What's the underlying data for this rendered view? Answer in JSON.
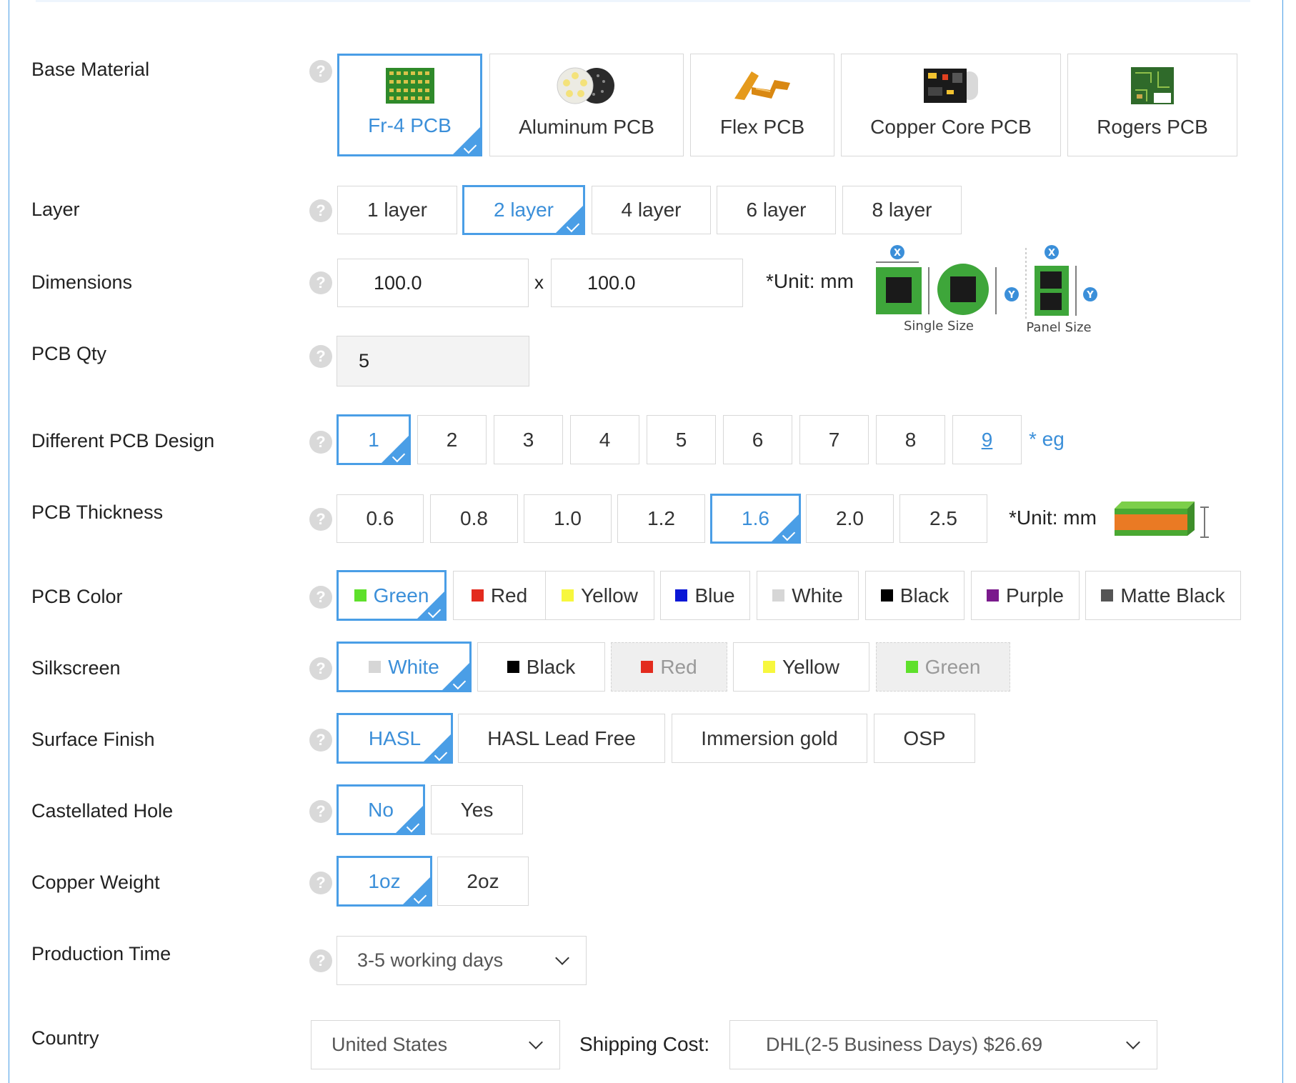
{
  "colors": {
    "accent": "#4a9ee6",
    "accent_text": "#3b8fd9"
  },
  "base_material": {
    "label": "Base Material",
    "options": [
      "Fr-4 PCB",
      "Aluminum PCB",
      "Flex PCB",
      "Copper Core PCB",
      "Rogers PCB"
    ],
    "selected": "Fr-4 PCB"
  },
  "layer": {
    "label": "Layer",
    "options": [
      "1 layer",
      "2 layer",
      "4 layer",
      "6 layer",
      "8 layer"
    ],
    "selected": "2 layer"
  },
  "dimensions": {
    "label": "Dimensions",
    "width_value": "100.0",
    "separator": "x",
    "height_value": "100.0",
    "unit": "*Unit: mm",
    "diagram_single": "Single Size",
    "diagram_panel": "Panel Size",
    "axis_x": "X",
    "axis_y": "Y"
  },
  "pcb_qty": {
    "label": "PCB Qty",
    "value": "5"
  },
  "different_design": {
    "label": "Different PCB Design",
    "options": [
      "1",
      "2",
      "3",
      "4",
      "5",
      "6",
      "7",
      "8",
      "9"
    ],
    "selected": "1",
    "eg_text": "* eg"
  },
  "thickness": {
    "label": "PCB Thickness",
    "options": [
      "0.6",
      "0.8",
      "1.0",
      "1.2",
      "1.6",
      "2.0",
      "2.5"
    ],
    "selected": "1.6",
    "unit": "*Unit: mm"
  },
  "pcb_color": {
    "label": "PCB Color",
    "options": [
      {
        "name": "Green",
        "swatch": "#5ee02b"
      },
      {
        "name": "Red",
        "swatch": "#e32b1e"
      },
      {
        "name": "Yellow",
        "swatch": "#f7f73d"
      },
      {
        "name": "Blue",
        "swatch": "#0a17d6"
      },
      {
        "name": "White",
        "swatch": "#d6d6d6"
      },
      {
        "name": "Black",
        "swatch": "#000000"
      },
      {
        "name": "Purple",
        "swatch": "#7a1a8c"
      },
      {
        "name": "Matte Black",
        "swatch": "#555555"
      }
    ],
    "selected": "Green"
  },
  "silkscreen": {
    "label": "Silkscreen",
    "options": [
      {
        "name": "White",
        "swatch": "#d6d6d6"
      },
      {
        "name": "Black",
        "swatch": "#000000"
      },
      {
        "name": "Red",
        "swatch": "#e32b1e"
      },
      {
        "name": "Yellow",
        "swatch": "#f7f73d"
      },
      {
        "name": "Green",
        "swatch": "#5ee02b"
      }
    ],
    "selected": "White"
  },
  "surface_finish": {
    "label": "Surface Finish",
    "options": [
      "HASL",
      "HASL Lead Free",
      "Immersion gold",
      "OSP"
    ],
    "selected": "HASL"
  },
  "castellated": {
    "label": "Castellated Hole",
    "options": [
      "No",
      "Yes"
    ],
    "selected": "No"
  },
  "copper_weight": {
    "label": "Copper Weight",
    "options": [
      "1oz",
      "2oz"
    ],
    "selected": "1oz"
  },
  "production_time": {
    "label": "Production Time",
    "value": "3-5 working days"
  },
  "country": {
    "label": "Country",
    "value": "United States",
    "shipping_label": "Shipping Cost:",
    "shipping_value": "DHL(2-5 Business Days) $26.69"
  }
}
